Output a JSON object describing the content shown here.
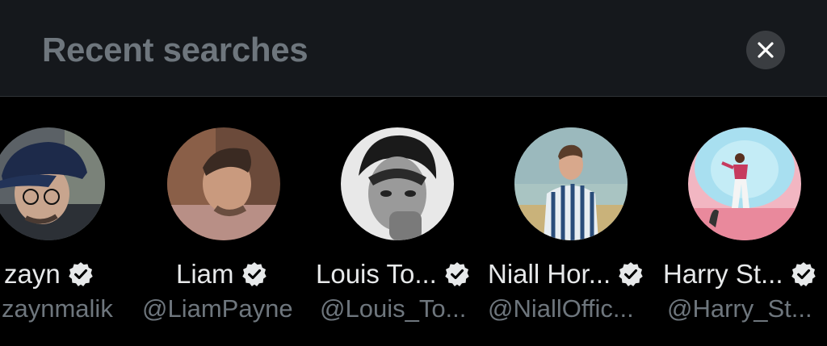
{
  "header": {
    "title": "Recent searches",
    "close_icon": "close-icon"
  },
  "colors": {
    "background": "#000000",
    "header_background": "#15181c",
    "title_text": "#6e767d",
    "name_text": "#e7e9ea",
    "handle_text": "#6e767d",
    "verified_badge": "#e7e9ea"
  },
  "recent_searches": [
    {
      "name": "zayn",
      "handle": "zaynmalik",
      "verified": true
    },
    {
      "name": "Liam",
      "handle": "@LiamPayne",
      "verified": true
    },
    {
      "name": "Louis To...",
      "handle": "@Louis_To...",
      "verified": true
    },
    {
      "name": "Niall Hor...",
      "handle": "@NiallOffic...",
      "verified": true
    },
    {
      "name": "Harry St...",
      "handle": "@Harry_St...",
      "verified": true
    }
  ]
}
